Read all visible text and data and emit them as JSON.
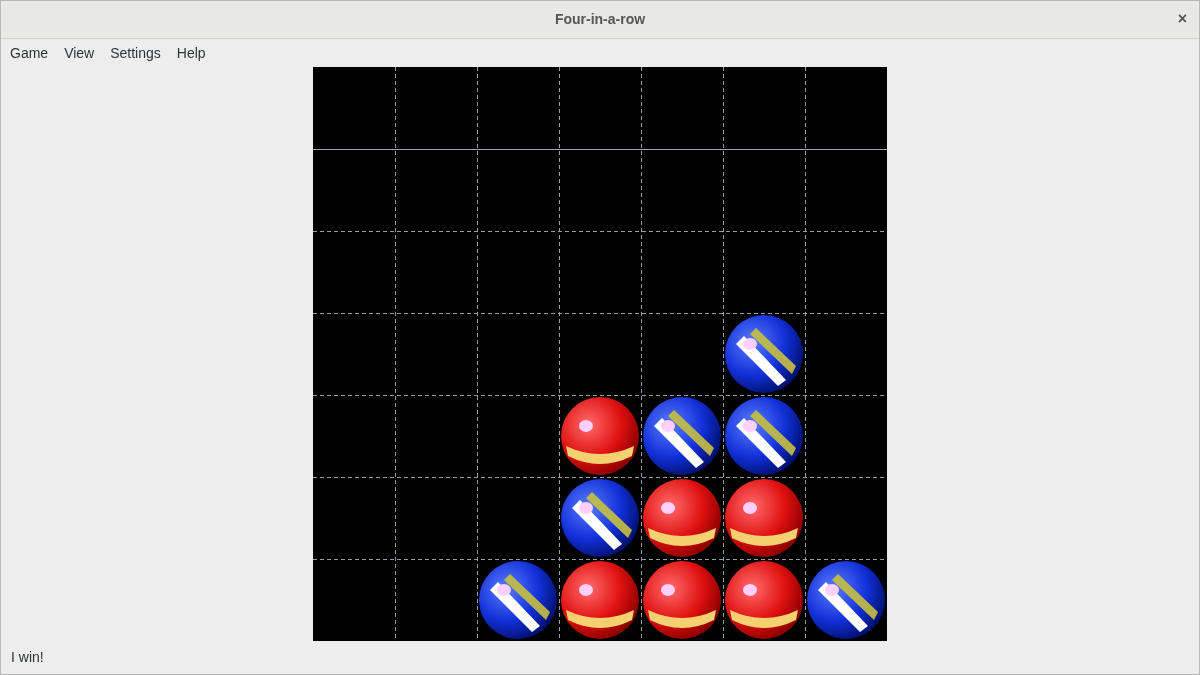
{
  "window": {
    "title": "Four-in-a-row",
    "close": "×"
  },
  "menu": [
    "Game",
    "View",
    "Settings",
    "Help"
  ],
  "board": {
    "rows": [
      {
        "cells": [
          {
            "kind": "empty"
          },
          {
            "kind": "empty"
          },
          {
            "kind": "empty"
          },
          {
            "kind": "empty"
          },
          {
            "kind": "empty"
          },
          {
            "kind": "empty"
          },
          {
            "kind": "empty"
          }
        ]
      },
      {
        "cells": [
          {
            "kind": "empty"
          },
          {
            "kind": "empty"
          },
          {
            "kind": "empty"
          },
          {
            "kind": "empty"
          },
          {
            "kind": "empty"
          },
          {
            "kind": "empty"
          },
          {
            "kind": "empty"
          }
        ]
      },
      {
        "cells": [
          {
            "kind": "empty"
          },
          {
            "kind": "empty"
          },
          {
            "kind": "empty"
          },
          {
            "kind": "empty"
          },
          {
            "kind": "empty"
          },
          {
            "kind": "empty"
          },
          {
            "kind": "empty"
          }
        ]
      },
      {
        "cells": [
          {
            "kind": "empty"
          },
          {
            "kind": "empty"
          },
          {
            "kind": "empty"
          },
          {
            "kind": "empty"
          },
          {
            "kind": "empty"
          },
          {
            "kind": "blue"
          },
          {
            "kind": "empty"
          }
        ]
      },
      {
        "cells": [
          {
            "kind": "empty"
          },
          {
            "kind": "empty"
          },
          {
            "kind": "empty"
          },
          {
            "kind": "red"
          },
          {
            "kind": "blue"
          },
          {
            "kind": "blue"
          },
          {
            "kind": "empty"
          }
        ]
      },
      {
        "cells": [
          {
            "kind": "empty"
          },
          {
            "kind": "empty"
          },
          {
            "kind": "empty"
          },
          {
            "kind": "blue"
          },
          {
            "kind": "red"
          },
          {
            "kind": "red"
          },
          {
            "kind": "empty"
          }
        ]
      },
      {
        "cells": [
          {
            "kind": "empty"
          },
          {
            "kind": "empty"
          },
          {
            "kind": "blue"
          },
          {
            "kind": "red"
          },
          {
            "kind": "red"
          },
          {
            "kind": "red"
          },
          {
            "kind": "blue"
          }
        ]
      }
    ]
  },
  "status_bar": "I win!"
}
